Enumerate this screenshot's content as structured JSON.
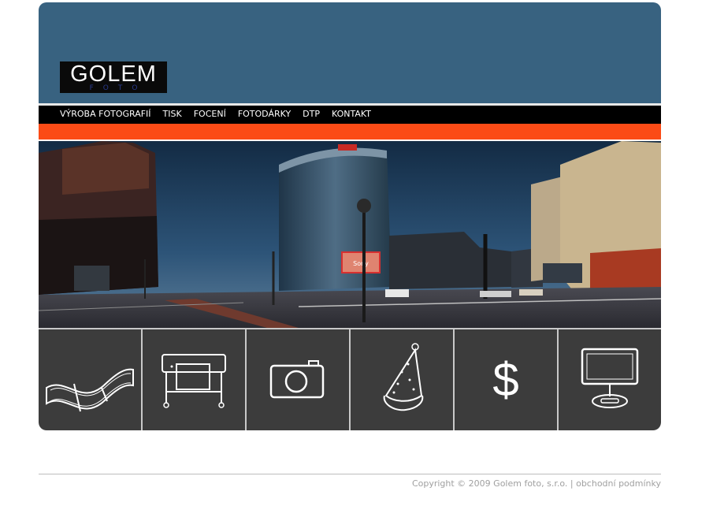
{
  "logo": {
    "main": "GOLEM",
    "sub": "FOTO"
  },
  "nav": [
    {
      "label": "VÝROBA FOTOGRAFIÍ"
    },
    {
      "label": "TISK"
    },
    {
      "label": "FOCENÍ"
    },
    {
      "label": "FOTODÁRKY"
    },
    {
      "label": "DTP"
    },
    {
      "label": "KONTAKT"
    }
  ],
  "icons": [
    "film-strip-icon",
    "plotter-printer-icon",
    "camera-icon",
    "party-hat-icon",
    "dollar-icon",
    "monitor-icon"
  ],
  "billboard": "Sony",
  "footer": {
    "copyright": "Copyright © 2009 Golem foto, s.r.o.",
    "divider": "|",
    "terms": "obchodní podmínky"
  },
  "colors": {
    "header": "#386280",
    "orange": "#fb4b16",
    "tile": "#3c3c3c",
    "bottom": "#9a9a9a"
  }
}
